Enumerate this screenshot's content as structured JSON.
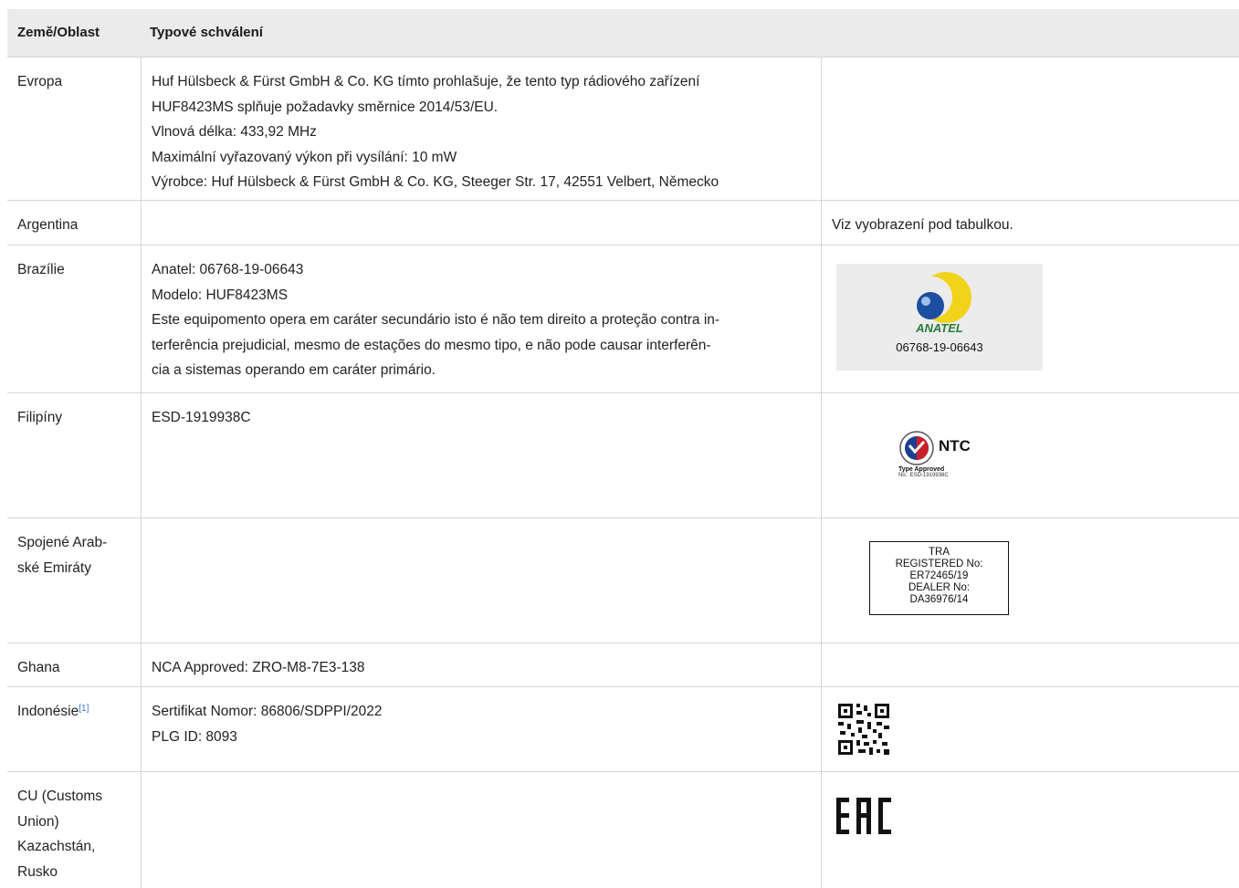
{
  "header": {
    "col1": "Země/Oblast",
    "col2": "Typové schválení"
  },
  "rows": [
    {
      "country": "Evropa",
      "lines": [
        "Huf Hülsbeck & Fürst GmbH & Co. KG tímto prohlašuje, že tento typ rádiového zařízení",
        "HUF8423MS splňuje požadavky směrnice 2014/53/EU.",
        "Vlnová délka: 433,92 MHz",
        "Maximální vyřazovaný výkon při vysílání: 10 mW",
        "Výrobce: Huf Hülsbeck & Fürst GmbH & Co. KG, Steeger Str. 17, 42551 Velbert, Německo"
      ]
    },
    {
      "country": "Argentina",
      "mark_text": "Viz vyobrazení pod tabulkou."
    },
    {
      "country": "Brazílie",
      "lines": [
        "Anatel: 06768-19-06643",
        "Modelo: HUF8423MS",
        "Este equipomento opera em caráter secundário isto é não tem direito a proteção contra in-",
        "terferência prejudicial, mesmo de estações do mesmo tipo, e não pode causar interferên-",
        "cia a sistemas operando em caráter primário."
      ],
      "logo": {
        "name": "ANATEL",
        "number": "06768-19-06643"
      }
    },
    {
      "country": "Filipíny",
      "lines": [
        "ESD-1919938C"
      ],
      "logo": {
        "name": "NTC",
        "caption": "Type Approved",
        "number": "No.: ESD-1919938C"
      }
    },
    {
      "country_lines": [
        "Spojené Arab-",
        "ské Emiráty"
      ],
      "logo_lines": [
        "TRA",
        "REGISTERED No:",
        "ER72465/19",
        "DEALER No:",
        "DA36976/14"
      ]
    },
    {
      "country": "Ghana",
      "lines": [
        "NCA Approved: ZRO-M8-7E3-138"
      ]
    },
    {
      "country": "Indonésie",
      "footnote": "[1]",
      "lines": [
        "Sertifikat Nomor: 86806/SDPPI/2022",
        "PLG ID: 8093"
      ]
    },
    {
      "country_lines": [
        "CU (Customs",
        "Union)",
        "Kazachstán,",
        "Rusko"
      ]
    }
  ],
  "colors": {
    "header_bg": "#ebebeb",
    "border": "#d6d6d6",
    "anatel_green": "#2a7a3a",
    "anatel_yellow": "#f2d31b",
    "anatel_blue": "#1d4fa0"
  }
}
